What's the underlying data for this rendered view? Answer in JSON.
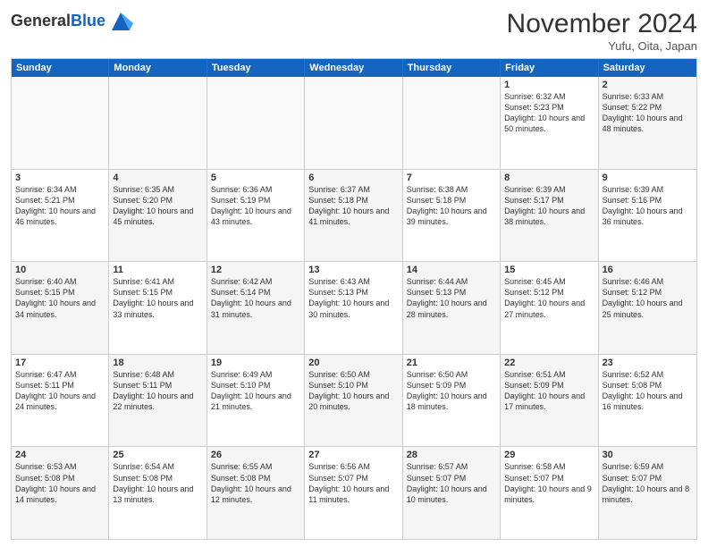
{
  "logo": {
    "general": "General",
    "blue": "Blue"
  },
  "title": "November 2024",
  "location": "Yufu, Oita, Japan",
  "header_days": [
    "Sunday",
    "Monday",
    "Tuesday",
    "Wednesday",
    "Thursday",
    "Friday",
    "Saturday"
  ],
  "weeks": [
    [
      {
        "day": "",
        "text": "",
        "empty": true
      },
      {
        "day": "",
        "text": "",
        "empty": true
      },
      {
        "day": "",
        "text": "",
        "empty": true
      },
      {
        "day": "",
        "text": "",
        "empty": true
      },
      {
        "day": "",
        "text": "",
        "empty": true
      },
      {
        "day": "1",
        "text": "Sunrise: 6:32 AM\nSunset: 5:23 PM\nDaylight: 10 hours and 50 minutes.",
        "empty": false
      },
      {
        "day": "2",
        "text": "Sunrise: 6:33 AM\nSunset: 5:22 PM\nDaylight: 10 hours and 48 minutes.",
        "empty": false
      }
    ],
    [
      {
        "day": "3",
        "text": "Sunrise: 6:34 AM\nSunset: 5:21 PM\nDaylight: 10 hours and 46 minutes.",
        "empty": false
      },
      {
        "day": "4",
        "text": "Sunrise: 6:35 AM\nSunset: 5:20 PM\nDaylight: 10 hours and 45 minutes.",
        "empty": false
      },
      {
        "day": "5",
        "text": "Sunrise: 6:36 AM\nSunset: 5:19 PM\nDaylight: 10 hours and 43 minutes.",
        "empty": false
      },
      {
        "day": "6",
        "text": "Sunrise: 6:37 AM\nSunset: 5:18 PM\nDaylight: 10 hours and 41 minutes.",
        "empty": false
      },
      {
        "day": "7",
        "text": "Sunrise: 6:38 AM\nSunset: 5:18 PM\nDaylight: 10 hours and 39 minutes.",
        "empty": false
      },
      {
        "day": "8",
        "text": "Sunrise: 6:39 AM\nSunset: 5:17 PM\nDaylight: 10 hours and 38 minutes.",
        "empty": false
      },
      {
        "day": "9",
        "text": "Sunrise: 6:39 AM\nSunset: 5:16 PM\nDaylight: 10 hours and 36 minutes.",
        "empty": false
      }
    ],
    [
      {
        "day": "10",
        "text": "Sunrise: 6:40 AM\nSunset: 5:15 PM\nDaylight: 10 hours and 34 minutes.",
        "empty": false
      },
      {
        "day": "11",
        "text": "Sunrise: 6:41 AM\nSunset: 5:15 PM\nDaylight: 10 hours and 33 minutes.",
        "empty": false
      },
      {
        "day": "12",
        "text": "Sunrise: 6:42 AM\nSunset: 5:14 PM\nDaylight: 10 hours and 31 minutes.",
        "empty": false
      },
      {
        "day": "13",
        "text": "Sunrise: 6:43 AM\nSunset: 5:13 PM\nDaylight: 10 hours and 30 minutes.",
        "empty": false
      },
      {
        "day": "14",
        "text": "Sunrise: 6:44 AM\nSunset: 5:13 PM\nDaylight: 10 hours and 28 minutes.",
        "empty": false
      },
      {
        "day": "15",
        "text": "Sunrise: 6:45 AM\nSunset: 5:12 PM\nDaylight: 10 hours and 27 minutes.",
        "empty": false
      },
      {
        "day": "16",
        "text": "Sunrise: 6:46 AM\nSunset: 5:12 PM\nDaylight: 10 hours and 25 minutes.",
        "empty": false
      }
    ],
    [
      {
        "day": "17",
        "text": "Sunrise: 6:47 AM\nSunset: 5:11 PM\nDaylight: 10 hours and 24 minutes.",
        "empty": false
      },
      {
        "day": "18",
        "text": "Sunrise: 6:48 AM\nSunset: 5:11 PM\nDaylight: 10 hours and 22 minutes.",
        "empty": false
      },
      {
        "day": "19",
        "text": "Sunrise: 6:49 AM\nSunset: 5:10 PM\nDaylight: 10 hours and 21 minutes.",
        "empty": false
      },
      {
        "day": "20",
        "text": "Sunrise: 6:50 AM\nSunset: 5:10 PM\nDaylight: 10 hours and 20 minutes.",
        "empty": false
      },
      {
        "day": "21",
        "text": "Sunrise: 6:50 AM\nSunset: 5:09 PM\nDaylight: 10 hours and 18 minutes.",
        "empty": false
      },
      {
        "day": "22",
        "text": "Sunrise: 6:51 AM\nSunset: 5:09 PM\nDaylight: 10 hours and 17 minutes.",
        "empty": false
      },
      {
        "day": "23",
        "text": "Sunrise: 6:52 AM\nSunset: 5:08 PM\nDaylight: 10 hours and 16 minutes.",
        "empty": false
      }
    ],
    [
      {
        "day": "24",
        "text": "Sunrise: 6:53 AM\nSunset: 5:08 PM\nDaylight: 10 hours and 14 minutes.",
        "empty": false
      },
      {
        "day": "25",
        "text": "Sunrise: 6:54 AM\nSunset: 5:08 PM\nDaylight: 10 hours and 13 minutes.",
        "empty": false
      },
      {
        "day": "26",
        "text": "Sunrise: 6:55 AM\nSunset: 5:08 PM\nDaylight: 10 hours and 12 minutes.",
        "empty": false
      },
      {
        "day": "27",
        "text": "Sunrise: 6:56 AM\nSunset: 5:07 PM\nDaylight: 10 hours and 11 minutes.",
        "empty": false
      },
      {
        "day": "28",
        "text": "Sunrise: 6:57 AM\nSunset: 5:07 PM\nDaylight: 10 hours and 10 minutes.",
        "empty": false
      },
      {
        "day": "29",
        "text": "Sunrise: 6:58 AM\nSunset: 5:07 PM\nDaylight: 10 hours and 9 minutes.",
        "empty": false
      },
      {
        "day": "30",
        "text": "Sunrise: 6:59 AM\nSunset: 5:07 PM\nDaylight: 10 hours and 8 minutes.",
        "empty": false
      }
    ]
  ]
}
